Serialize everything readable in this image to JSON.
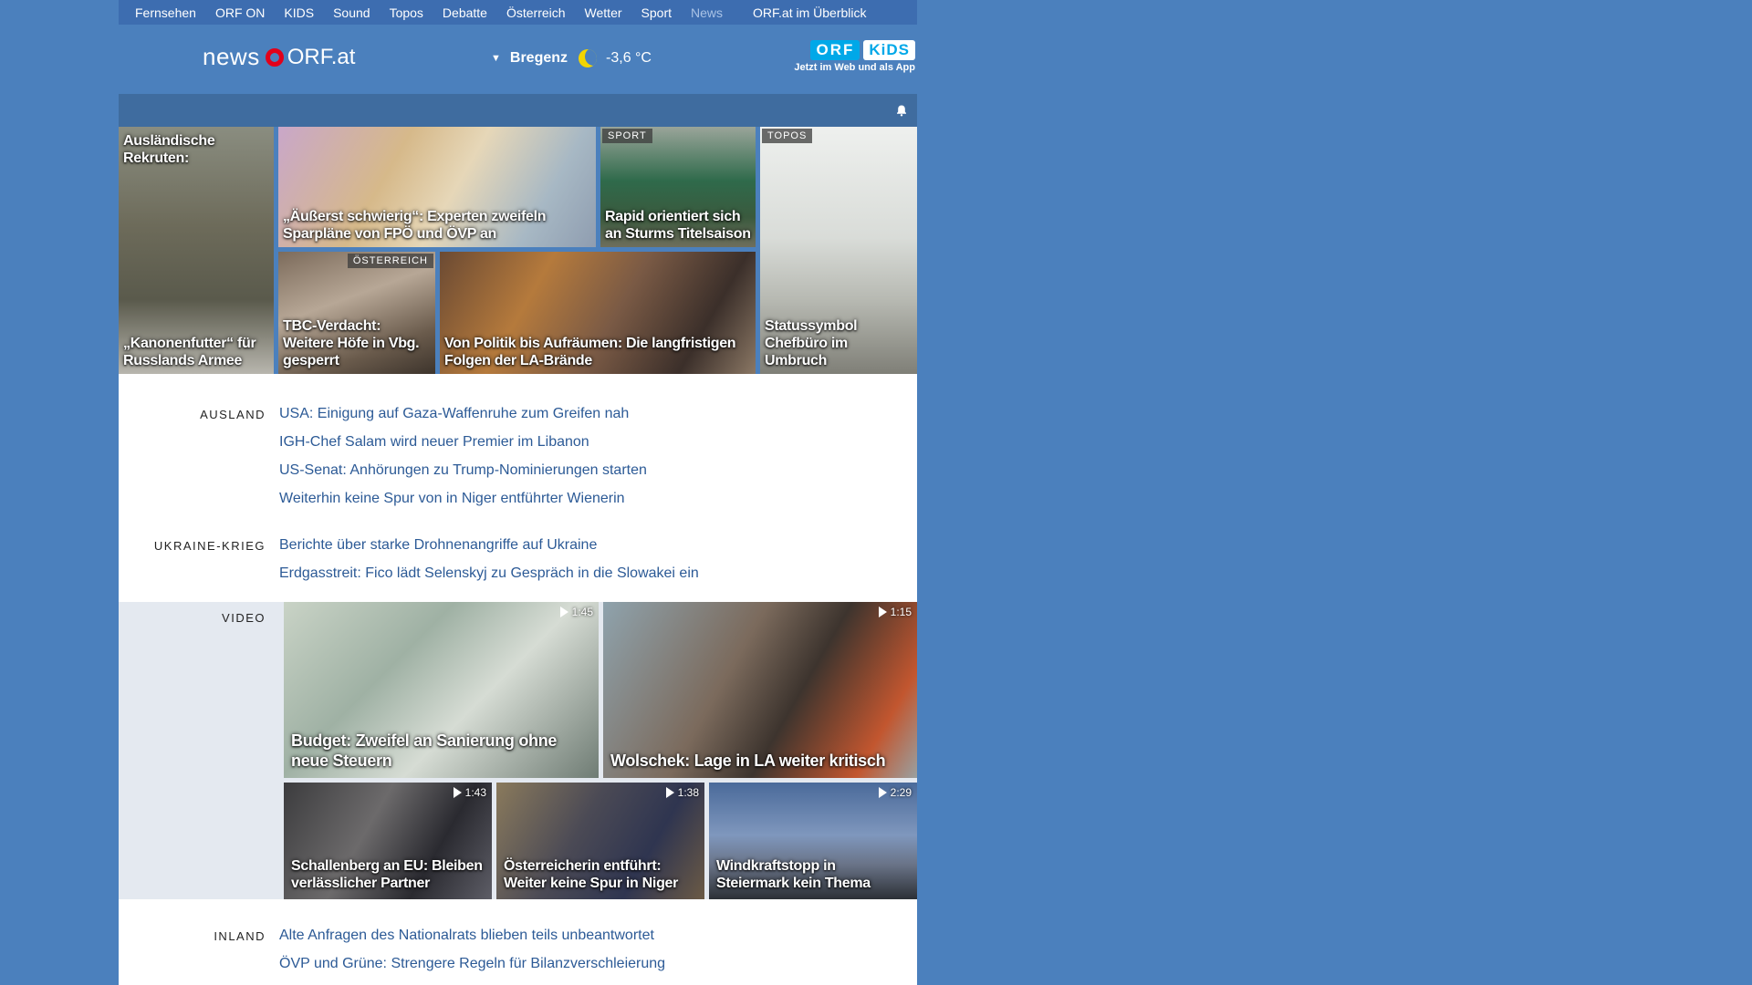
{
  "nav": {
    "items": [
      "Fernsehen",
      "ORF ON",
      "KIDS",
      "Sound",
      "Topos",
      "Debatte",
      "Österreich",
      "Wetter",
      "Sport",
      "News"
    ],
    "active": "News",
    "overview": "ORF.at im Überblick"
  },
  "header": {
    "logo_news": "news",
    "logo_orf": "ORF.at",
    "location": "Bregenz",
    "temperature": "-3,6 °C",
    "kids_orf": "ORF",
    "kids_kids": "KiDS",
    "kids_tagline": "Jetzt im Web und als App"
  },
  "tiles": [
    {
      "headline": "Ausländische Rekruten: „Kanonenfutter“ für Russlands Armee",
      "headline_top": "Ausländische Rekruten:",
      "headline_bottom": "„Kanonenfutter“ für Russlands Armee",
      "tag": ""
    },
    {
      "headline": "„Äußerst schwierig“: Experten zweifeln Sparpläne von FPÖ und ÖVP an",
      "tag": ""
    },
    {
      "headline": "Rapid orientiert sich an Sturms Titelsaison",
      "tag": "SPORT"
    },
    {
      "headline": "Statussymbol Chefbüro im Umbruch",
      "tag": "TOPOS"
    },
    {
      "headline": "TBC-Verdacht: Weitere Höfe in Vbg. gesperrt",
      "tag": "ÖSTERREICH"
    },
    {
      "headline": "Von Politik bis Aufräumen: Die langfristigen Folgen der LA-Brände",
      "tag": ""
    }
  ],
  "sections": {
    "ausland": {
      "label": "AUSLAND",
      "links": [
        "USA: Einigung auf Gaza-Waffenruhe zum Greifen nah",
        "IGH-Chef Salam wird neuer Premier im Libanon",
        "US-Senat: Anhörungen zu Trump-Nominierungen starten",
        "Weiterhin keine Spur von in Niger entführter Wienerin"
      ]
    },
    "ukraine": {
      "label": "UKRAINE-KRIEG",
      "links": [
        "Berichte über starke Drohnenangriffe auf Ukraine",
        "Erdgasstreit: Fico lädt Selenskyj zu Gespräch in die Slowakei ein"
      ]
    },
    "video": {
      "label": "VIDEO",
      "items": [
        {
          "title": "Budget: Zweifel an Sanierung ohne neue Steuern",
          "duration": "1:45"
        },
        {
          "title": "Wolschek: Lage in LA weiter kritisch",
          "duration": "1:15"
        },
        {
          "title": "Schallenberg an EU: Bleiben verlässlicher Partner",
          "duration": "1:43"
        },
        {
          "title": "Österreicherin entführt: Weiter keine Spur in Niger",
          "duration": "1:38"
        },
        {
          "title": "Windkraftstopp in Steiermark kein Thema",
          "duration": "2:29"
        }
      ]
    },
    "inland": {
      "label": "INLAND",
      "links": [
        "Alte Anfragen des Nationalrats blieben teils unbeantwortet",
        "ÖVP und Grüne: Strengere Regeln für Bilanzverschleierung"
      ]
    }
  }
}
